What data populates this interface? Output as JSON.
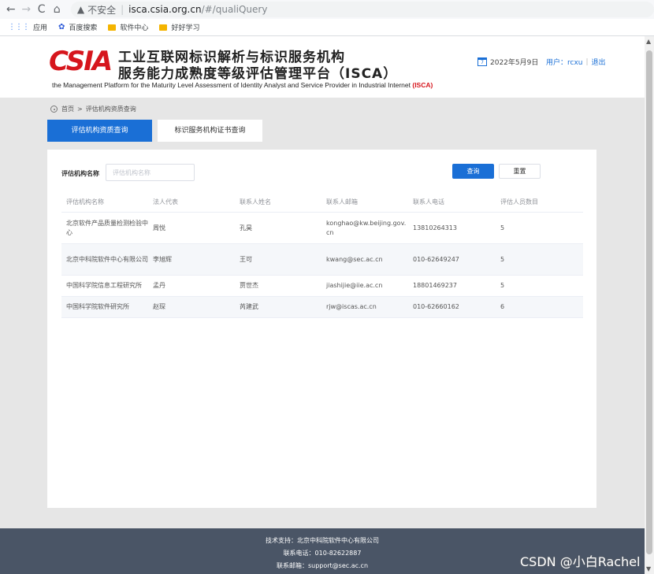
{
  "browser": {
    "back_icon": "←",
    "forward_icon": "→",
    "reload_icon": "C",
    "home_icon": "⌂",
    "warning_icon": "▲",
    "insecure_label": "不安全",
    "url_host": "isca.csia.org.cn",
    "url_path": "/#/qualiQuery",
    "bookmarks": {
      "apps": "应用",
      "baidu": "百度搜索",
      "software_center": "软件中心",
      "study": "好好学习"
    }
  },
  "header": {
    "logo": "CSIA",
    "title_line1": "工业互联网标识解析与标识服务机构",
    "title_line2": "服务能力成熟度等级评估管理平台（ISCA）",
    "subtitle_en": "the Management Platform for the Maturity Level Assessment of Identity Analyst and Service Provider in Industrial Internet",
    "subtitle_tag": "(ISCA)",
    "date": "2022年5月9日",
    "user_label": "用户：rcxu",
    "logout": "退出"
  },
  "breadcrumb": {
    "home": "首页",
    "sep": ">",
    "current": "评估机构资质查询"
  },
  "tabs": [
    {
      "label": "评估机构资质查询",
      "active": true
    },
    {
      "label": "标识服务机构证书查询",
      "active": false
    }
  ],
  "search": {
    "label": "评估机构名称",
    "placeholder": "评估机构名称",
    "query_button": "查询",
    "reset_button": "重置"
  },
  "table": {
    "headers": [
      "评估机构名称",
      "法人代表",
      "联系人姓名",
      "联系人邮箱",
      "联系人电话",
      "评估人员数目"
    ],
    "rows": [
      [
        "北京软件产品质量检测检验中心",
        "周悦",
        "孔昊",
        "konghao@kw.beijing.gov.cn",
        "13810264313",
        "5"
      ],
      [
        "北京中科院软件中心有限公司",
        "李旭辉",
        "王可",
        "kwang@sec.ac.cn",
        "010-62649247",
        "5"
      ],
      [
        "中国科学院信息工程研究所",
        "孟丹",
        "贾世杰",
        "jiashijie@iie.ac.cn",
        "18801469237",
        "5"
      ],
      [
        "中国科学院软件研究所",
        "赵琛",
        "芮建武",
        "rjw@iscas.ac.cn",
        "010-62660162",
        "6"
      ]
    ]
  },
  "footer": {
    "support": "技术支持：北京中科院软件中心有限公司",
    "phone": "联系电话：010-82622887",
    "email": "联系邮箱：support@sec.ac.cn"
  },
  "watermark": "CSDN @小白Rachel",
  "colors": {
    "accent": "#1a6fd6",
    "brand_red": "#d6161d",
    "footer_bg": "#4a5566",
    "page_bg": "#e6e6e6"
  }
}
